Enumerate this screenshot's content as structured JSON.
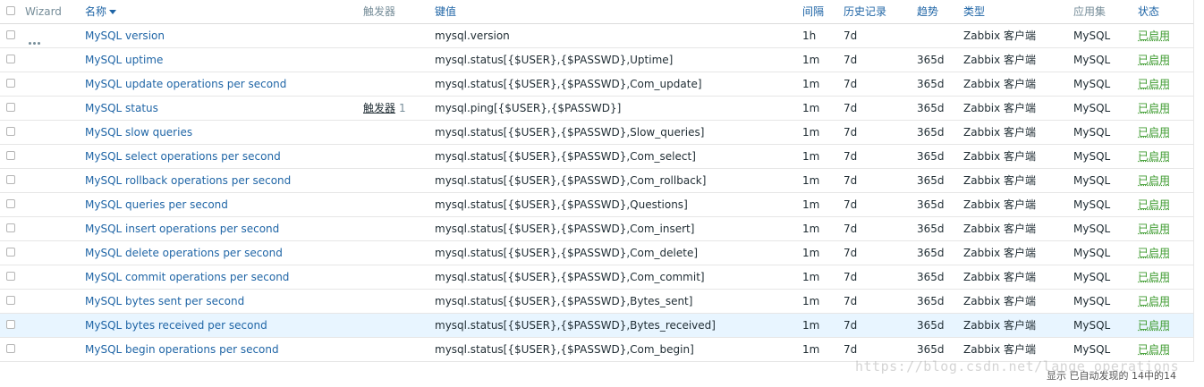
{
  "header": {
    "wizard": "Wizard",
    "name": "名称",
    "triggers": "触发器",
    "key": "键值",
    "interval": "间隔",
    "history": "历史记录",
    "trends": "趋势",
    "type": "类型",
    "applications": "应用集",
    "status": "状态"
  },
  "rows": [
    {
      "name": "MySQL version",
      "triggers": "",
      "trigger_count": "",
      "key": "mysql.version",
      "interval": "1h",
      "history": "7d",
      "trends": "",
      "type": "Zabbix 客户端",
      "app": "MySQL",
      "status": "已启用"
    },
    {
      "name": "MySQL uptime",
      "triggers": "",
      "trigger_count": "",
      "key": "mysql.status[{$USER},{$PASSWD},Uptime]",
      "interval": "1m",
      "history": "7d",
      "trends": "365d",
      "type": "Zabbix 客户端",
      "app": "MySQL",
      "status": "已启用"
    },
    {
      "name": "MySQL update operations per second",
      "triggers": "",
      "trigger_count": "",
      "key": "mysql.status[{$USER},{$PASSWD},Com_update]",
      "interval": "1m",
      "history": "7d",
      "trends": "365d",
      "type": "Zabbix 客户端",
      "app": "MySQL",
      "status": "已启用"
    },
    {
      "name": "MySQL status",
      "triggers": "触发器",
      "trigger_count": "1",
      "key": "mysql.ping[{$USER},{$PASSWD}]",
      "interval": "1m",
      "history": "7d",
      "trends": "365d",
      "type": "Zabbix 客户端",
      "app": "MySQL",
      "status": "已启用"
    },
    {
      "name": "MySQL slow queries",
      "triggers": "",
      "trigger_count": "",
      "key": "mysql.status[{$USER},{$PASSWD},Slow_queries]",
      "interval": "1m",
      "history": "7d",
      "trends": "365d",
      "type": "Zabbix 客户端",
      "app": "MySQL",
      "status": "已启用"
    },
    {
      "name": "MySQL select operations per second",
      "triggers": "",
      "trigger_count": "",
      "key": "mysql.status[{$USER},{$PASSWD},Com_select]",
      "interval": "1m",
      "history": "7d",
      "trends": "365d",
      "type": "Zabbix 客户端",
      "app": "MySQL",
      "status": "已启用"
    },
    {
      "name": "MySQL rollback operations per second",
      "triggers": "",
      "trigger_count": "",
      "key": "mysql.status[{$USER},{$PASSWD},Com_rollback]",
      "interval": "1m",
      "history": "7d",
      "trends": "365d",
      "type": "Zabbix 客户端",
      "app": "MySQL",
      "status": "已启用"
    },
    {
      "name": "MySQL queries per second",
      "triggers": "",
      "trigger_count": "",
      "key": "mysql.status[{$USER},{$PASSWD},Questions]",
      "interval": "1m",
      "history": "7d",
      "trends": "365d",
      "type": "Zabbix 客户端",
      "app": "MySQL",
      "status": "已启用"
    },
    {
      "name": "MySQL insert operations per second",
      "triggers": "",
      "trigger_count": "",
      "key": "mysql.status[{$USER},{$PASSWD},Com_insert]",
      "interval": "1m",
      "history": "7d",
      "trends": "365d",
      "type": "Zabbix 客户端",
      "app": "MySQL",
      "status": "已启用"
    },
    {
      "name": "MySQL delete operations per second",
      "triggers": "",
      "trigger_count": "",
      "key": "mysql.status[{$USER},{$PASSWD},Com_delete]",
      "interval": "1m",
      "history": "7d",
      "trends": "365d",
      "type": "Zabbix 客户端",
      "app": "MySQL",
      "status": "已启用"
    },
    {
      "name": "MySQL commit operations per second",
      "triggers": "",
      "trigger_count": "",
      "key": "mysql.status[{$USER},{$PASSWD},Com_commit]",
      "interval": "1m",
      "history": "7d",
      "trends": "365d",
      "type": "Zabbix 客户端",
      "app": "MySQL",
      "status": "已启用"
    },
    {
      "name": "MySQL bytes sent per second",
      "triggers": "",
      "trigger_count": "",
      "key": "mysql.status[{$USER},{$PASSWD},Bytes_sent]",
      "interval": "1m",
      "history": "7d",
      "trends": "365d",
      "type": "Zabbix 客户端",
      "app": "MySQL",
      "status": "已启用"
    },
    {
      "name": "MySQL bytes received per second",
      "triggers": "",
      "trigger_count": "",
      "key": "mysql.status[{$USER},{$PASSWD},Bytes_received]",
      "interval": "1m",
      "history": "7d",
      "trends": "365d",
      "type": "Zabbix 客户端",
      "app": "MySQL",
      "status": "已启用",
      "highlighted": true
    },
    {
      "name": "MySQL begin operations per second",
      "triggers": "",
      "trigger_count": "",
      "key": "mysql.status[{$USER},{$PASSWD},Com_begin]",
      "interval": "1m",
      "history": "7d",
      "trends": "365d",
      "type": "Zabbix 客户端",
      "app": "MySQL",
      "status": "已启用"
    }
  ],
  "footer": "显示 已自动发现的 14中的14",
  "watermark": "https://blog.csdn.net/lange_operations",
  "colors": {
    "link": "#1f65a6",
    "status_enabled": "#3c9a2e",
    "row_highlight": "#e8f5ff"
  }
}
